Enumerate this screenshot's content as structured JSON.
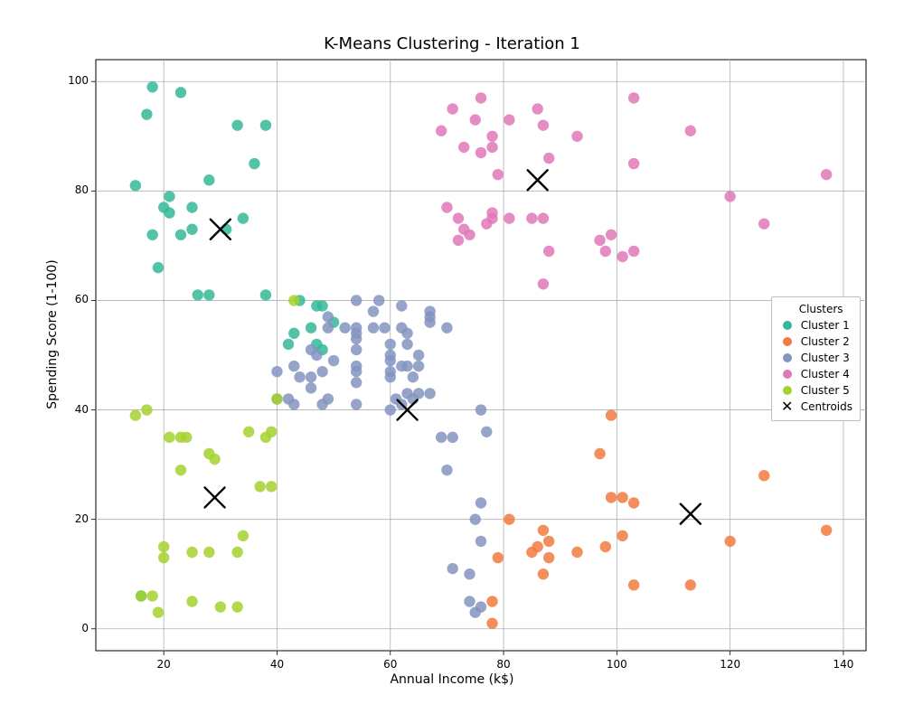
{
  "chart_data": {
    "type": "scatter",
    "title": "K-Means Clustering - Iteration 1",
    "xlabel": "Annual Income (k$)",
    "ylabel": "Spending Score (1-100)",
    "xlim": [
      8,
      144
    ],
    "ylim": [
      -4,
      104
    ],
    "xticks": [
      20,
      40,
      60,
      80,
      100,
      120,
      140
    ],
    "yticks": [
      0,
      20,
      40,
      60,
      80,
      100
    ],
    "legend_title": "Clusters",
    "grid": true,
    "legend_position": "right",
    "series": [
      {
        "name": "Cluster 1",
        "color": "#35b898",
        "points": [
          [
            15,
            81
          ],
          [
            16,
            6
          ],
          [
            17,
            94
          ],
          [
            18,
            72
          ],
          [
            18,
            99
          ],
          [
            19,
            66
          ],
          [
            20,
            77
          ],
          [
            21,
            76
          ],
          [
            21,
            79
          ],
          [
            23,
            72
          ],
          [
            23,
            98
          ],
          [
            25,
            73
          ],
          [
            25,
            77
          ],
          [
            26,
            61
          ],
          [
            28,
            82
          ],
          [
            28,
            61
          ],
          [
            31,
            73
          ],
          [
            33,
            92
          ],
          [
            34,
            75
          ],
          [
            36,
            85
          ],
          [
            38,
            92
          ],
          [
            38,
            61
          ],
          [
            42,
            52
          ],
          [
            43,
            54
          ],
          [
            44,
            60
          ],
          [
            46,
            55
          ],
          [
            47,
            52
          ],
          [
            47,
            59
          ],
          [
            48,
            59
          ],
          [
            48,
            51
          ],
          [
            50,
            56
          ]
        ]
      },
      {
        "name": "Cluster 2",
        "color": "#f27b3f",
        "points": [
          [
            78,
            1
          ],
          [
            78,
            5
          ],
          [
            79,
            13
          ],
          [
            81,
            20
          ],
          [
            85,
            14
          ],
          [
            86,
            15
          ],
          [
            87,
            10
          ],
          [
            87,
            18
          ],
          [
            88,
            13
          ],
          [
            88,
            16
          ],
          [
            93,
            14
          ],
          [
            97,
            32
          ],
          [
            98,
            15
          ],
          [
            99,
            24
          ],
          [
            99,
            39
          ],
          [
            101,
            24
          ],
          [
            101,
            17
          ],
          [
            103,
            23
          ],
          [
            103,
            8
          ],
          [
            113,
            8
          ],
          [
            120,
            16
          ],
          [
            126,
            28
          ],
          [
            137,
            18
          ]
        ]
      },
      {
        "name": "Cluster 3",
        "color": "#8494bf",
        "points": [
          [
            40,
            47
          ],
          [
            40,
            42
          ],
          [
            42,
            42
          ],
          [
            43,
            48
          ],
          [
            43,
            41
          ],
          [
            44,
            46
          ],
          [
            46,
            51
          ],
          [
            46,
            46
          ],
          [
            46,
            44
          ],
          [
            47,
            50
          ],
          [
            48,
            47
          ],
          [
            48,
            41
          ],
          [
            49,
            55
          ],
          [
            49,
            42
          ],
          [
            49,
            57
          ],
          [
            50,
            49
          ],
          [
            52,
            55
          ],
          [
            54,
            47
          ],
          [
            54,
            54
          ],
          [
            54,
            53
          ],
          [
            54,
            48
          ],
          [
            54,
            60
          ],
          [
            54,
            45
          ],
          [
            54,
            41
          ],
          [
            54,
            51
          ],
          [
            54,
            55
          ],
          [
            57,
            55
          ],
          [
            57,
            58
          ],
          [
            58,
            60
          ],
          [
            59,
            55
          ],
          [
            60,
            46
          ],
          [
            60,
            40
          ],
          [
            60,
            49
          ],
          [
            60,
            52
          ],
          [
            60,
            47
          ],
          [
            60,
            50
          ],
          [
            61,
            42
          ],
          [
            62,
            41
          ],
          [
            62,
            48
          ],
          [
            62,
            55
          ],
          [
            62,
            59
          ],
          [
            63,
            43
          ],
          [
            63,
            48
          ],
          [
            63,
            52
          ],
          [
            63,
            54
          ],
          [
            64,
            42
          ],
          [
            64,
            46
          ],
          [
            65,
            48
          ],
          [
            65,
            50
          ],
          [
            65,
            43
          ],
          [
            67,
            43
          ],
          [
            67,
            57
          ],
          [
            67,
            56
          ],
          [
            67,
            58
          ],
          [
            69,
            35
          ],
          [
            70,
            29
          ],
          [
            70,
            55
          ],
          [
            71,
            35
          ],
          [
            71,
            11
          ],
          [
            75,
            20
          ],
          [
            76,
            16
          ],
          [
            76,
            4
          ],
          [
            76,
            40
          ],
          [
            77,
            36
          ],
          [
            74,
            5
          ],
          [
            74,
            10
          ],
          [
            75,
            3
          ],
          [
            76,
            23
          ]
        ]
      },
      {
        "name": "Cluster 4",
        "color": "#e079b8",
        "points": [
          [
            69,
            91
          ],
          [
            70,
            77
          ],
          [
            71,
            95
          ],
          [
            72,
            71
          ],
          [
            72,
            75
          ],
          [
            73,
            73
          ],
          [
            73,
            88
          ],
          [
            74,
            72
          ],
          [
            75,
            93
          ],
          [
            76,
            87
          ],
          [
            76,
            97
          ],
          [
            77,
            74
          ],
          [
            78,
            90
          ],
          [
            78,
            88
          ],
          [
            78,
            76
          ],
          [
            78,
            75
          ],
          [
            79,
            83
          ],
          [
            81,
            93
          ],
          [
            81,
            75
          ],
          [
            85,
            75
          ],
          [
            86,
            95
          ],
          [
            87,
            63
          ],
          [
            87,
            75
          ],
          [
            87,
            92
          ],
          [
            88,
            69
          ],
          [
            88,
            86
          ],
          [
            93,
            90
          ],
          [
            97,
            71
          ],
          [
            98,
            69
          ],
          [
            99,
            72
          ],
          [
            101,
            68
          ],
          [
            103,
            69
          ],
          [
            103,
            85
          ],
          [
            103,
            97
          ],
          [
            113,
            91
          ],
          [
            120,
            79
          ],
          [
            126,
            74
          ],
          [
            137,
            83
          ]
        ]
      },
      {
        "name": "Cluster 5",
        "color": "#a5d22e",
        "points": [
          [
            15,
            39
          ],
          [
            16,
            6
          ],
          [
            17,
            40
          ],
          [
            18,
            6
          ],
          [
            19,
            3
          ],
          [
            20,
            13
          ],
          [
            20,
            15
          ],
          [
            21,
            35
          ],
          [
            23,
            29
          ],
          [
            23,
            35
          ],
          [
            24,
            35
          ],
          [
            25,
            5
          ],
          [
            25,
            14
          ],
          [
            28,
            14
          ],
          [
            28,
            32
          ],
          [
            29,
            31
          ],
          [
            30,
            4
          ],
          [
            33,
            4
          ],
          [
            33,
            14
          ],
          [
            34,
            17
          ],
          [
            35,
            36
          ],
          [
            37,
            26
          ],
          [
            38,
            35
          ],
          [
            39,
            36
          ],
          [
            39,
            26
          ],
          [
            40,
            42
          ],
          [
            43,
            60
          ]
        ]
      }
    ],
    "centroids": [
      {
        "x": 30,
        "y": 73
      },
      {
        "x": 113,
        "y": 21
      },
      {
        "x": 63,
        "y": 40
      },
      {
        "x": 86,
        "y": 82
      },
      {
        "x": 29,
        "y": 24
      }
    ],
    "centroid_label": "Centroids",
    "centroid_color": "#000000"
  },
  "layout": {
    "fig_w": 1000,
    "fig_h": 800,
    "axes": {
      "left": 106,
      "top": 66,
      "right": 958,
      "bottom": 720
    }
  }
}
